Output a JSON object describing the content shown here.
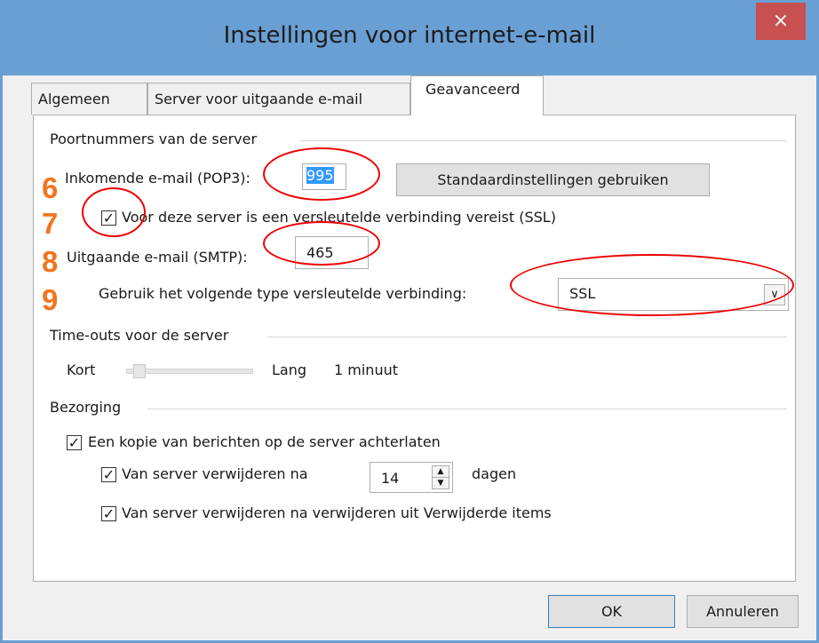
{
  "window": {
    "title": "Instellingen voor internet-e-mail",
    "close_glyph": "×"
  },
  "tabs": [
    {
      "label": "Algemeen"
    },
    {
      "label": "Server voor uitgaande e-mail"
    },
    {
      "label": "Geavanceerd"
    }
  ],
  "ports": {
    "section": "Poortnummers van de server",
    "incoming_label": "Inkomende e-mail (POP3):",
    "incoming_value": "995",
    "defaults_button": "Standaardinstellingen gebruiken",
    "ssl_checkbox_label": "Voor deze server is een versleutelde verbinding vereist (SSL)",
    "ssl_checked": true,
    "outgoing_label": "Uitgaande e-mail (SMTP):",
    "outgoing_value": "465",
    "encryption_label": "Gebruik het volgende type versleutelde verbinding:",
    "encryption_value": "SSL"
  },
  "timeouts": {
    "section": "Time-outs voor de server",
    "short": "Kort",
    "long": "Lang",
    "value": "1 minuut"
  },
  "delivery": {
    "section": "Bezorging",
    "leave_copy": "Een kopie van berichten op de server achterlaten",
    "remove_after": "Van server verwijderen na",
    "days_value": "14",
    "days_unit": "dagen",
    "remove_when_deleted": "Van server verwijderen na verwijderen uit Verwijderde items"
  },
  "footer": {
    "ok": "OK",
    "cancel": "Annuleren"
  },
  "annotations": [
    "6",
    "7",
    "8",
    "9"
  ],
  "colors": {
    "titlebar": "#6a9fd4",
    "close": "#c75050",
    "annotation": "#f2741f",
    "ring": "#e00000"
  }
}
